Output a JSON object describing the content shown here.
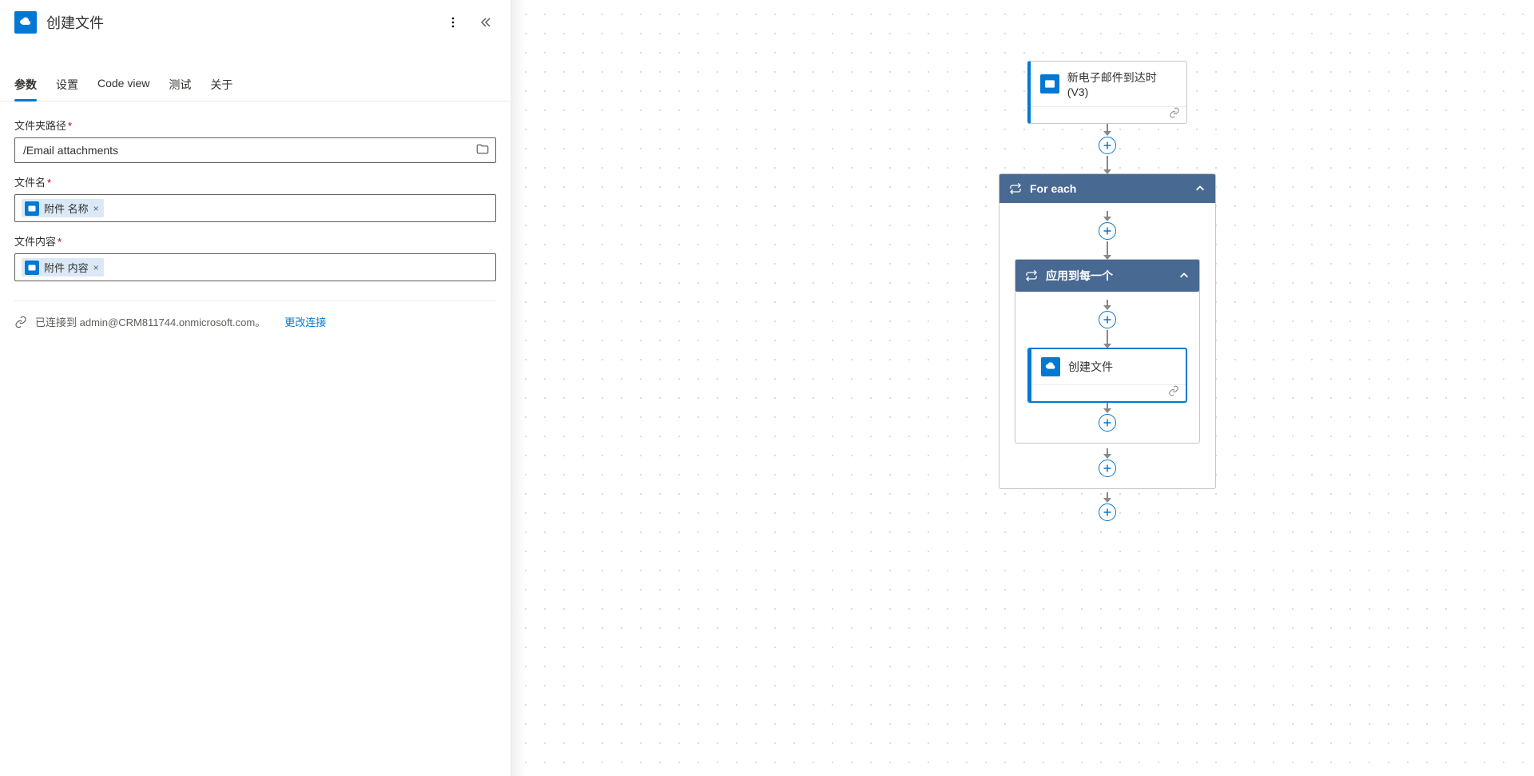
{
  "panel": {
    "title": "创建文件",
    "tabs": {
      "params": "参数",
      "settings": "设置",
      "code_view": "Code view",
      "test": "测试",
      "about": "关于"
    },
    "fields": {
      "folder_path_label": "文件夹路径",
      "folder_path_value": "/Email attachments",
      "file_name_label": "文件名",
      "file_name_token": "附件 名称",
      "file_content_label": "文件内容",
      "file_content_token": "附件 内容"
    },
    "connection": {
      "text": "已连接到 admin@CRM811744.onmicrosoft.com。",
      "change": "更改连接"
    }
  },
  "flow": {
    "trigger_title": "新电子邮件到达时(V3)",
    "for_each_title": "For each",
    "apply_each_title": "应用到每一个",
    "create_file_title": "创建文件"
  }
}
